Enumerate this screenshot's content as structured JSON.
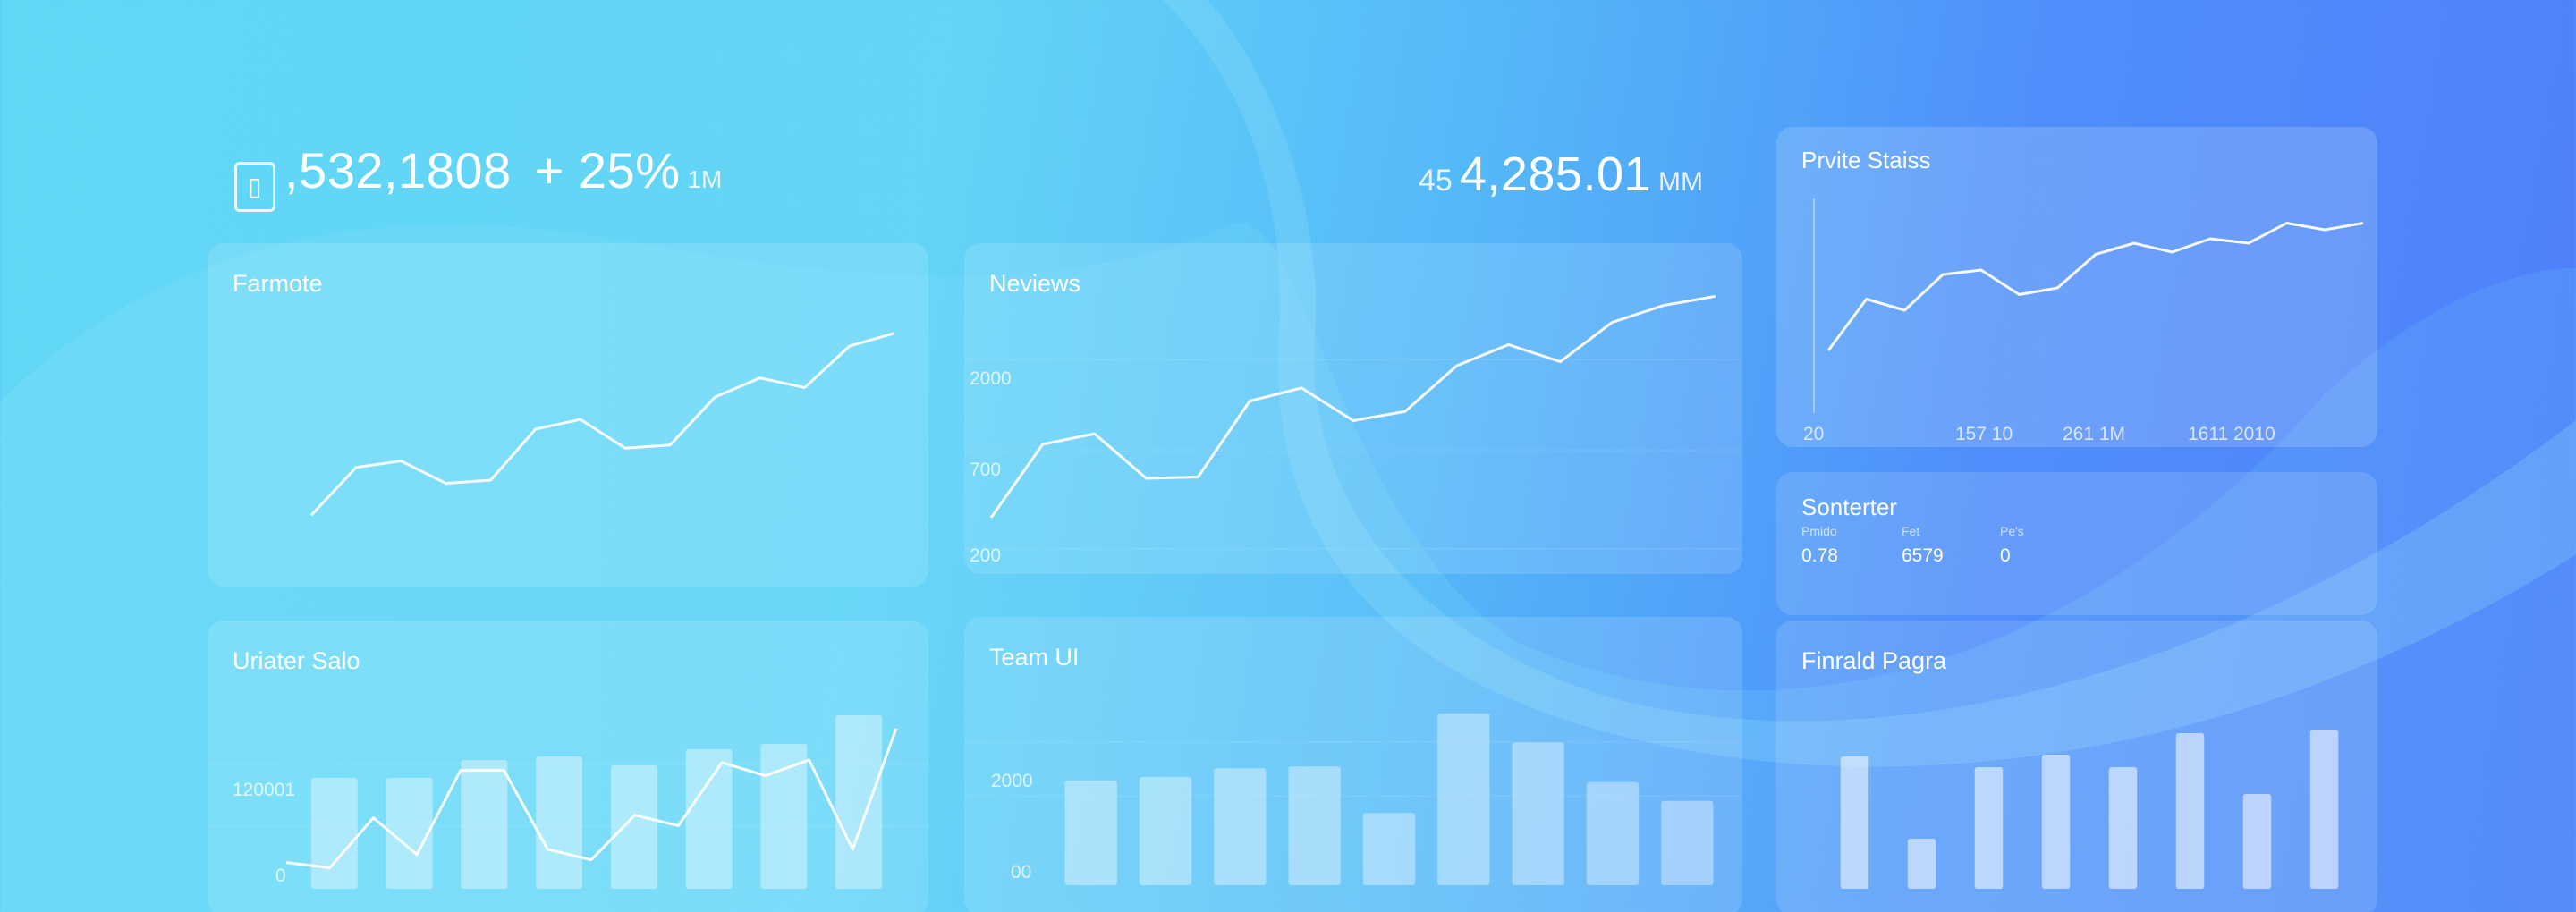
{
  "kpis": {
    "left": {
      "icon": "document-icon",
      "value": ",532,1808",
      "delta": "+ 25%",
      "unit": "1M"
    },
    "right": {
      "prefix": "45",
      "value": "4,285.01",
      "unit": "MM"
    }
  },
  "panels": {
    "farmote": {
      "title": "Farmote",
      "chart_data": {
        "type": "line",
        "y": [
          10,
          25,
          27,
          20,
          21,
          37,
          40,
          31,
          32,
          47,
          53,
          50,
          63,
          67
        ]
      }
    },
    "reviews": {
      "title": "Neviews",
      "chart_data": {
        "type": "line",
        "y_ticks": [
          "2000",
          "700",
          "200"
        ],
        "y": [
          260,
          820,
          900,
          560,
          570,
          1150,
          1250,
          1000,
          1070,
          1420,
          1580,
          1450,
          1750,
          1880,
          1950
        ]
      }
    },
    "private_stats": {
      "title": "Prvite Staiss",
      "chart_data": {
        "type": "line",
        "x_ticks": [
          "20",
          "157 10",
          "261 1M",
          "1611 2010"
        ],
        "y": [
          20,
          43,
          38,
          54,
          56,
          45,
          48,
          63,
          68,
          64,
          70,
          68,
          77,
          74,
          77
        ]
      }
    },
    "sonterter": {
      "title": "Sonterter",
      "stats": [
        {
          "label": "Pmido",
          "value": "0.78"
        },
        {
          "label": "Fet",
          "value": "6579"
        },
        {
          "label": "Pe's",
          "value": "0"
        }
      ]
    },
    "uriater": {
      "title": "Uriater Salo",
      "chart_data": {
        "type": "bar",
        "y_ticks": [
          "120001",
          "0"
        ],
        "values": [
          62,
          62,
          72,
          74,
          69,
          78,
          81,
          97
        ],
        "line": [
          10,
          8,
          27,
          13,
          45,
          45,
          15,
          11,
          28,
          24,
          48,
          43,
          49,
          15,
          61
        ]
      }
    },
    "team": {
      "title": "Team UI",
      "chart_data": {
        "type": "bar",
        "y_ticks": [
          "2000",
          "00"
        ],
        "values": [
          61,
          63,
          68,
          69,
          42,
          100,
          83,
          60,
          49
        ]
      }
    },
    "finrald": {
      "title": "Finrald Pagra",
      "chart_data": {
        "type": "bar",
        "values": [
          74,
          28,
          68,
          75,
          68,
          87,
          53,
          89
        ]
      }
    }
  }
}
